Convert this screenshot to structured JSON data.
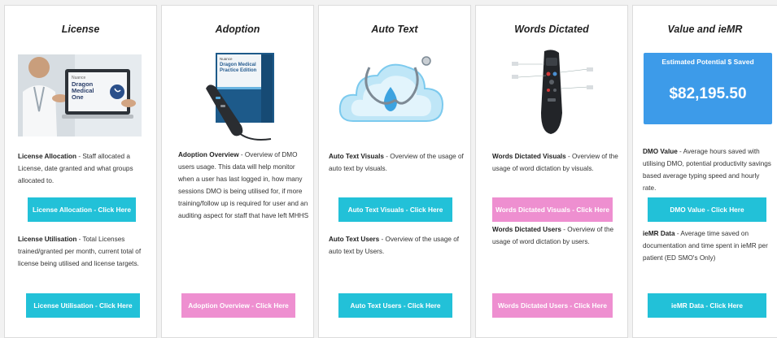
{
  "cards": [
    {
      "title": "License",
      "image_text": [
        "Nuance",
        "Dragon",
        "Medical",
        "One"
      ],
      "sections": [
        {
          "heading": "License Allocation",
          "body": " - Staff allocated a License, date granted and what groups allocated to.",
          "button": "License Allocation - Click Here"
        },
        {
          "heading": "License Utilisation",
          "body": " - Total Licenses trained/granted per month, current total of license being utilised and license targets.",
          "button": "License Utilisation - Click Here"
        }
      ]
    },
    {
      "title": "Adoption",
      "image_text": [
        "Nuance",
        "Dragon Medical",
        "Practice Edition"
      ],
      "sections": [
        {
          "heading": "Adoption Overview",
          "body": " - Overview of DMO users usage. This data will help monitor when a user has last logged in, how many sessions DMO is being utilised for, if more training/follow up is required for user and an auditing aspect for staff that have left MHHS",
          "button": "Adoption Overview - Click Here"
        }
      ]
    },
    {
      "title": "Auto Text",
      "sections": [
        {
          "heading": "Auto Text Visuals",
          "body": " - Overview of the usage of auto text by visuals.",
          "button": "Auto Text Visuals - Click Here"
        },
        {
          "heading": "Auto Text Users",
          "body": " - Overview of the usage of auto text by Users.",
          "button": "Auto Text Users - Click Here"
        }
      ]
    },
    {
      "title": "Words Dictated",
      "sections": [
        {
          "heading": "Words Dictated Visuals",
          "body": " - Overview of the usage of word dictation by visuals.",
          "button": "Words Dictated Visuals - Click Here"
        },
        {
          "heading": "Words Dictated Users",
          "body": " - Overview of the usage of word dictation by users.",
          "button": "Words Dictated Users - Click Here"
        }
      ]
    },
    {
      "title": "Value and ieMR",
      "savings": {
        "label": "Estimated Potential $ Saved",
        "amount": "$82,195.50"
      },
      "sections": [
        {
          "heading": "DMO Value",
          "body": " - Average hours saved with utilising DMO, potential productivity savings based average typing speed and hourly rate.",
          "button": "DMO Value - Click Here"
        },
        {
          "heading": "ieMR Data",
          "body": " - Average time saved on documentation and time spent in ieMR per patient (ED SMO's Only)",
          "button": "ieMR Data - Click Here"
        }
      ]
    }
  ],
  "colors": {
    "teal": "#22c1d8",
    "pink": "#ee8fd0",
    "savings_bg": "#3d9be9"
  }
}
